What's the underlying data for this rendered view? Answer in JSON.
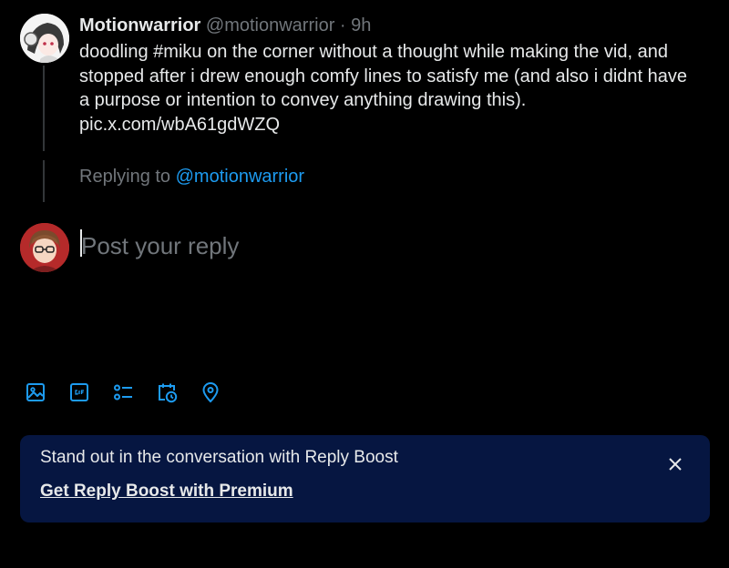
{
  "post": {
    "author_name": "Motionwarrior",
    "author_handle": "@motionwarrior",
    "separator": "·",
    "time": "9h",
    "text_lines": [
      "doodling #miku on the corner without a thought while making the vid, and",
      "stopped after i drew enough comfy lines to satisfy me (and also i didnt have",
      "a purpose or intention to convey anything drawing this).",
      "pic.x.com/wbA61gdWZQ"
    ]
  },
  "replying": {
    "prefix": "Replying to",
    "handle": "@motionwarrior"
  },
  "composer": {
    "placeholder": "Post your reply"
  },
  "toolbar": {
    "icons": [
      "image-icon",
      "gif-icon",
      "poll-icon",
      "schedule-icon",
      "location-icon"
    ]
  },
  "banner": {
    "text": "Stand out in the conversation with Reply Boost",
    "link_label": "Get Reply Boost with Premium"
  },
  "colors": {
    "accent": "#1d9bf0",
    "muted": "#71767b",
    "banner_bg": "#061641"
  }
}
